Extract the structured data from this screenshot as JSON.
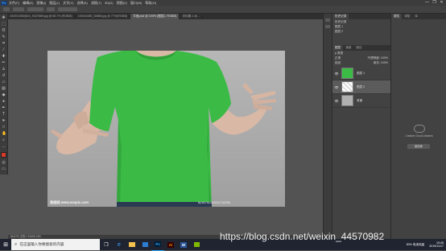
{
  "menu": {
    "app_icon": "Ps",
    "items": [
      "文件(F)",
      "编辑(E)",
      "图像(I)",
      "图层(L)",
      "文字(Y)",
      "选择(S)",
      "滤镜(T)",
      "3D(D)",
      "视图(V)",
      "窗口(W)",
      "帮助(H)"
    ],
    "window_buttons": [
      "—",
      "❐",
      "✕"
    ]
  },
  "tabs": [
    {
      "label": "1920X1080@2x_9437889.jpg @ 66.7% (RGB/8)",
      "active": false
    },
    {
      "label": "1920x1080_30888.jpg @ 77%(RGB/8)",
      "active": false
    },
    {
      "label": "平面.psd @ 100% (图层1, RGB/8)",
      "active": true
    },
    {
      "label": "未标题-1 @...",
      "active": false
    }
  ],
  "canvas": {
    "watermark_left": "我图网 www.ooopic.com",
    "watermark_right": "By:WZ-No:20201117102938"
  },
  "status": "66.67%   文档:1.91M/6.12M",
  "layers_panel": {
    "tabs": [
      "图层",
      "通道",
      "路径"
    ],
    "kind_label": "ρ 类型",
    "blend_mode": "正常",
    "opacity_label": "不透明度: 100%",
    "lock_label": "锁定:",
    "fill_label": "填充: 100%",
    "layers": [
      {
        "name": "图层 1",
        "visible": true,
        "selected": false,
        "thumb": "green-tshirt"
      },
      {
        "name": "图层 2",
        "visible": true,
        "selected": true,
        "thumb": "white-tshirt"
      },
      {
        "name": "背景",
        "visible": true,
        "selected": false,
        "thumb": "background"
      }
    ]
  },
  "history_panel": {
    "title": "历史记录",
    "rows": [
      "历史记录",
      "图层 1",
      "图层 2"
    ]
  },
  "right_panel": {
    "tabs": [
      "属性",
      "调整",
      "库"
    ],
    "message": "Creative Cloud Libraries",
    "link": "使用库"
  },
  "taskbar": {
    "search_placeholder": "在这里输入你要搜索的内容",
    "apps": [
      {
        "name": "Ps",
        "color": "#31a8ff",
        "bg": "#001e36"
      },
      {
        "name": "Ai",
        "color": "#ff9a00",
        "bg": "#330000"
      },
      {
        "name": "W",
        "color": "#ffffff",
        "bg": "#2b579a"
      }
    ],
    "clock_time": "19:45",
    "clock_date": "2019/11/17",
    "tray_text": "50% 电池电量"
  },
  "url_watermark": "https://blog.csdn.net/weixin_44570982",
  "colors": {
    "shirt_green": "#3bbb45",
    "foreground": "#d63a2b",
    "background": "#ffffff"
  }
}
